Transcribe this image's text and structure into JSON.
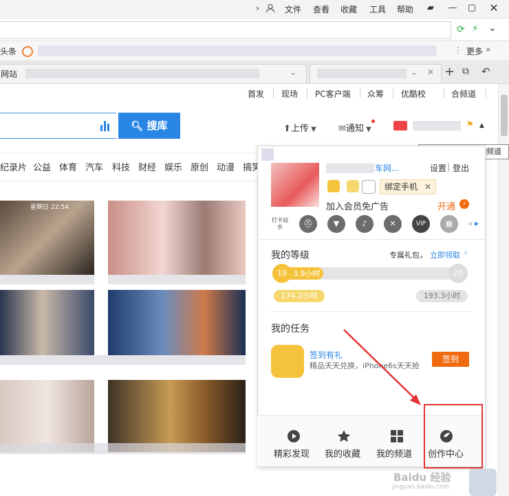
{
  "browser": {
    "menu": [
      "文件",
      "查看",
      "收藏",
      "工具",
      "帮助"
    ],
    "bookmark_first": "头条",
    "bookmark_more": "更多",
    "tab_title": "网站"
  },
  "site_nav": {
    "links": [
      "首发",
      "现场",
      "PC客户端",
      "众筹",
      "优酷校",
      "合频道"
    ]
  },
  "search": {
    "button_label": "搜库"
  },
  "header_actions": {
    "upload": "上传",
    "notify": "通知"
  },
  "tooltip": "中国二手车网视频频道",
  "categories": [
    "纪录片",
    "公益",
    "体育",
    "汽车",
    "科技",
    "财经",
    "娱乐",
    "原创",
    "动漫",
    "搞笑"
  ],
  "thumb_overlay": "星期日 22:54",
  "user_panel": {
    "name_fragment": "车网...",
    "settings": "设置",
    "logout": "登出",
    "bind_phone": "绑定手机",
    "vip_promo": "加入会员免广告",
    "open": "开通",
    "level_title": "我的等级",
    "gift_text": "专属礼包，",
    "gift_link": "立即领取",
    "level_current": "19",
    "level_next": "20",
    "hours_progress": "3.9小时",
    "hours_have": "174.2小时",
    "hours_need": "193.3小时",
    "level_progress": 0.04,
    "task_title": "我的任务",
    "task_name": "签到有礼",
    "task_desc": "精品天天兑换，iPhone6s天天抢",
    "checkin": "签到",
    "bottom": [
      "精彩发现",
      "我的收藏",
      "我的频道",
      "创作中心"
    ],
    "icon_badge": "打卡站长"
  },
  "watermark": "Baidu 经验",
  "watermark_sub": "jingyan.baidu.com",
  "colors": {
    "accent_blue": "#2a86e5",
    "orange": "#f06a0f",
    "level_gold": "#f5c23b",
    "annotation_red": "#e23434"
  }
}
